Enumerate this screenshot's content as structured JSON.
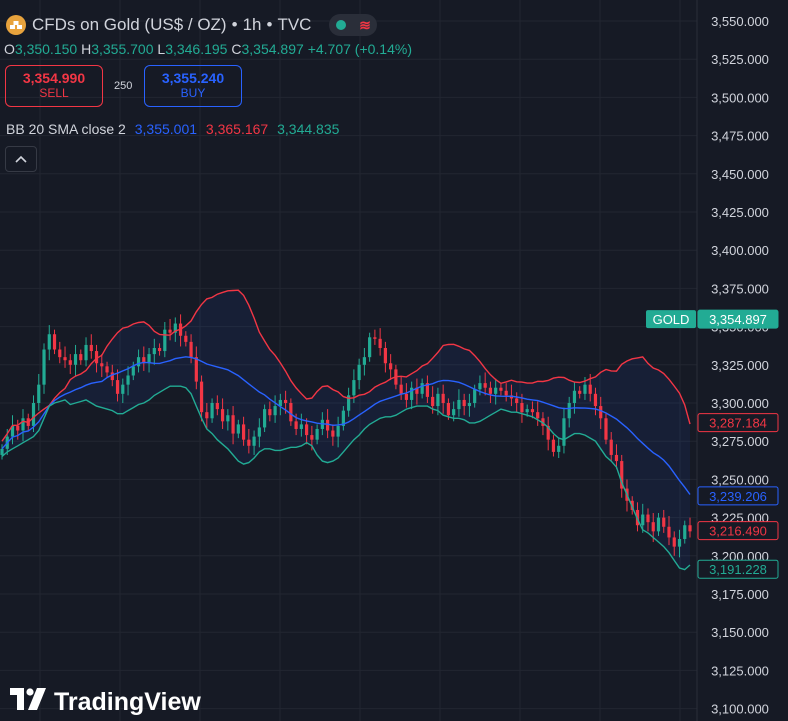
{
  "header": {
    "title": "CFDs on Gold (US$ / OZ)",
    "interval": "1h",
    "source": "TVC",
    "sep": "•",
    "status_icon": "wave-icon"
  },
  "ohlc": {
    "o_label": "O",
    "o": "3,350.150",
    "h_label": "H",
    "h": "3,355.700",
    "l_label": "L",
    "l": "3,346.195",
    "c_label": "C",
    "c": "3,354.897",
    "change": "+4.707 (+0.14%)"
  },
  "trade": {
    "sell_price": "3,354.990",
    "sell_label": "SELL",
    "spread": "250",
    "buy_price": "3,355.240",
    "buy_label": "BUY"
  },
  "indicator": {
    "label": "BB 20 SMA close 2",
    "basis": "3,355.001",
    "upper": "3,365.167",
    "lower": "3,344.835"
  },
  "branding": {
    "name": "TradingView"
  },
  "colors": {
    "background": "#161a25",
    "up": "#22ab94",
    "down": "#f23645",
    "basis": "#2962ff",
    "upper_band": "#f23645",
    "lower_band": "#22ab94"
  },
  "chart_data": {
    "type": "candlestick",
    "ylim": [
      3100,
      3550
    ],
    "y_ticks": [
      "3,550.000",
      "3,525.000",
      "3,500.000",
      "3,475.000",
      "3,450.000",
      "3,425.000",
      "3,400.000",
      "3,375.000",
      "3,350.000",
      "3,325.000",
      "3,300.000",
      "3,275.000",
      "3,250.000",
      "3,225.000",
      "3,200.000",
      "3,175.000",
      "3,150.000",
      "3,125.000",
      "3,100.000"
    ],
    "price_labels": [
      {
        "text": "GOLD",
        "value": "3,354.897",
        "kind": "symbol"
      },
      {
        "value": "3,287.184",
        "kind": "upper"
      },
      {
        "value": "3,239.206",
        "kind": "basis"
      },
      {
        "value": "3,216.490",
        "kind": "price"
      },
      {
        "value": "3,191.228",
        "kind": "lower"
      }
    ],
    "closes": [
      3270,
      3278,
      3285,
      3282,
      3290,
      3285,
      3300,
      3312,
      3335,
      3345,
      3335,
      3330,
      3328,
      3325,
      3332,
      3328,
      3338,
      3334,
      3326,
      3324,
      3320,
      3315,
      3306,
      3312,
      3318,
      3324,
      3330,
      3326,
      3332,
      3336,
      3334,
      3348,
      3346,
      3352,
      3344,
      3340,
      3330,
      3314,
      3294,
      3290,
      3300,
      3296,
      3288,
      3292,
      3280,
      3286,
      3276,
      3272,
      3278,
      3284,
      3296,
      3292,
      3298,
      3302,
      3300,
      3288,
      3283,
      3286,
      3279,
      3276,
      3283,
      3289,
      3282,
      3278,
      3285,
      3295,
      3305,
      3315,
      3325,
      3330,
      3343,
      3342,
      3336,
      3326,
      3322,
      3312,
      3306,
      3302,
      3310,
      3306,
      3313,
      3304,
      3298,
      3306,
      3300,
      3292,
      3296,
      3302,
      3298,
      3300,
      3309,
      3313,
      3310,
      3306,
      3310,
      3308,
      3305,
      3303,
      3300,
      3294,
      3296,
      3294,
      3290,
      3285,
      3276,
      3268,
      3272,
      3290,
      3300,
      3308,
      3306,
      3312,
      3306,
      3298,
      3290,
      3276,
      3266,
      3262,
      3244,
      3236,
      3230,
      3220,
      3227,
      3222,
      3216,
      3225,
      3219,
      3212,
      3206,
      3211,
      3220,
      3216
    ],
    "lower_band": [
      3265,
      3268,
      3270,
      3272,
      3274,
      3276,
      3278,
      3282,
      3290,
      3298,
      3300,
      3301,
      3302,
      3299,
      3300,
      3301,
      3302,
      3300,
      3298,
      3297,
      3296,
      3295,
      3293,
      3293,
      3295,
      3297,
      3299,
      3300,
      3302,
      3305,
      3307,
      3309,
      3311,
      3311,
      3311,
      3310,
      3306,
      3298,
      3290,
      3283,
      3280,
      3276,
      3273,
      3270,
      3266,
      3262,
      3260,
      3261,
      3264,
      3268,
      3270,
      3270,
      3269,
      3269,
      3270,
      3271,
      3271,
      3272,
      3274,
      3272,
      3266,
      3262,
      3261,
      3262,
      3264,
      3268,
      3272,
      3276,
      3279,
      3283,
      3286,
      3288,
      3290,
      3291,
      3291,
      3292,
      3294,
      3296,
      3297,
      3298,
      3298,
      3298,
      3296,
      3295,
      3292,
      3291,
      3290,
      3290,
      3289,
      3287,
      3287,
      3288,
      3290,
      3292,
      3294,
      3296,
      3295,
      3294,
      3294,
      3293,
      3292,
      3291,
      3289,
      3287,
      3284,
      3280,
      3277,
      3276,
      3278,
      3280,
      3280,
      3279,
      3277,
      3275,
      3270,
      3265,
      3262,
      3258,
      3248,
      3240,
      3232,
      3224,
      3217,
      3215,
      3212,
      3209,
      3206,
      3202,
      3197,
      3192,
      3191,
      3194
    ]
  }
}
